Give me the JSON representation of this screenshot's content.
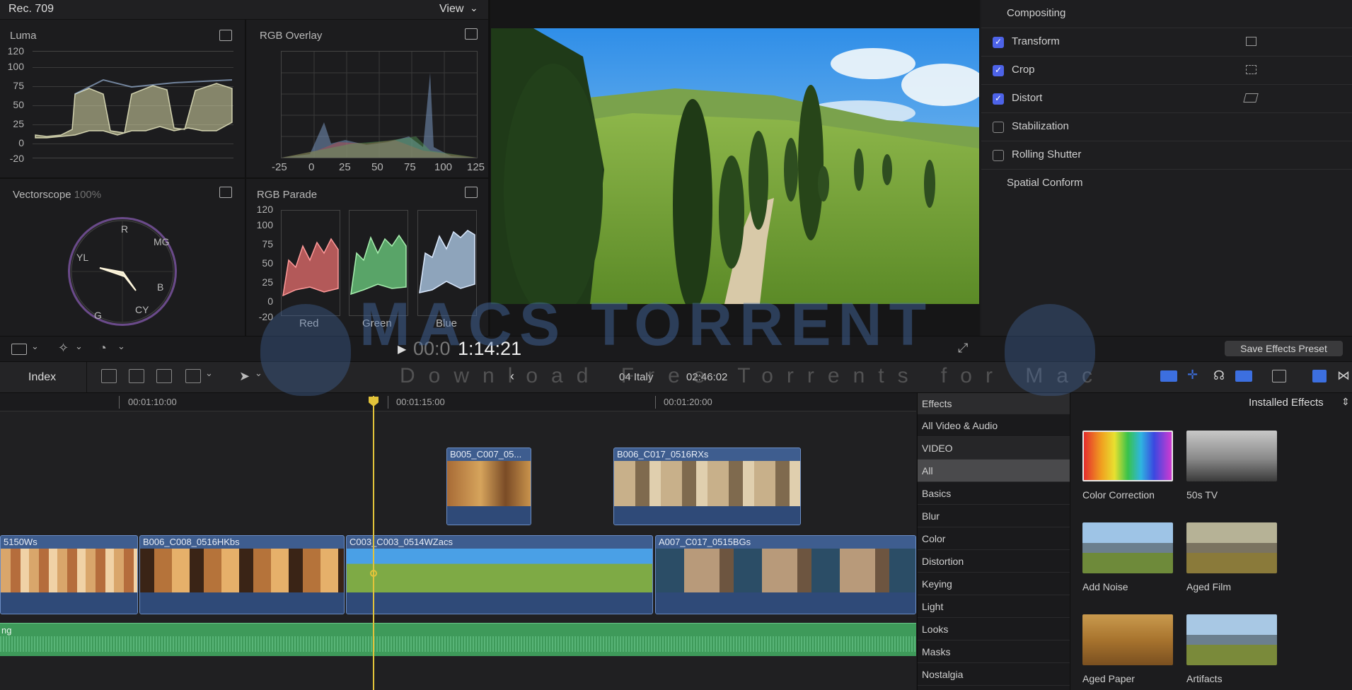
{
  "scopes": {
    "header_title": "Rec. 709",
    "view_menu": "View",
    "luma": {
      "title": "Luma",
      "ticks": [
        "120",
        "100",
        "75",
        "50",
        "25",
        "0",
        "-20"
      ]
    },
    "rgb_overlay": {
      "title": "RGB Overlay",
      "xticks": [
        "-25",
        "0",
        "25",
        "50",
        "75",
        "100",
        "125"
      ]
    },
    "vectorscope": {
      "title": "Vectorscope",
      "zoom": "100%",
      "targets": [
        "R",
        "MG",
        "YL",
        "B",
        "G",
        "CY"
      ]
    },
    "rgb_parade": {
      "title": "RGB Parade",
      "ticks": [
        "120",
        "100",
        "75",
        "50",
        "25",
        "0",
        "-20"
      ],
      "channels": [
        "Red",
        "Green",
        "Blue"
      ]
    }
  },
  "inspector": {
    "rows": [
      {
        "label": "Compositing",
        "checkbox": null
      },
      {
        "label": "Transform",
        "checkbox": true
      },
      {
        "label": "Crop",
        "checkbox": true
      },
      {
        "label": "Distort",
        "checkbox": true
      },
      {
        "label": "Stabilization",
        "checkbox": false
      },
      {
        "label": "Rolling Shutter",
        "checkbox": false
      },
      {
        "label": "Spatial Conform",
        "checkbox": null
      }
    ],
    "save_preset": "Save Effects Preset"
  },
  "viewer": {
    "timecode_dim": "00:0",
    "timecode": "1:14:21"
  },
  "timeline_bar": {
    "index": "Index",
    "project": "04 Italy",
    "duration": "02:46:02"
  },
  "ruler": {
    "marks": [
      "00:01:10:00",
      "00:01:15:00",
      "00:01:20:00"
    ]
  },
  "clips": {
    "connected": [
      "B005_C007_05...",
      "B006_C017_0516RXs"
    ],
    "primary": [
      "5150Ws",
      "B006_C008_0516HKbs",
      "C003_C003_0514WZacs",
      "A007_C017_0515BGs"
    ],
    "audio": "ng"
  },
  "effects": {
    "header": "Effects",
    "installed": "Installed Effects",
    "categories": [
      "All Video & Audio",
      "VIDEO",
      "All",
      "Basics",
      "Blur",
      "Color",
      "Distortion",
      "Keying",
      "Light",
      "Looks",
      "Masks",
      "Nostalgia"
    ],
    "selected": "All",
    "items": [
      "Color Correction",
      "50s TV",
      "Add Noise",
      "Aged Film",
      "Aged Paper",
      "Artifacts"
    ]
  },
  "watermark": {
    "title": "MACS TORRENT",
    "subtitle": "Download Free Torrents for Mac"
  },
  "colors": {
    "accent": "#4d63e8",
    "clip": "#3e5d8f",
    "audio": "#3e9a5a",
    "playhead": "#e2c33a"
  }
}
